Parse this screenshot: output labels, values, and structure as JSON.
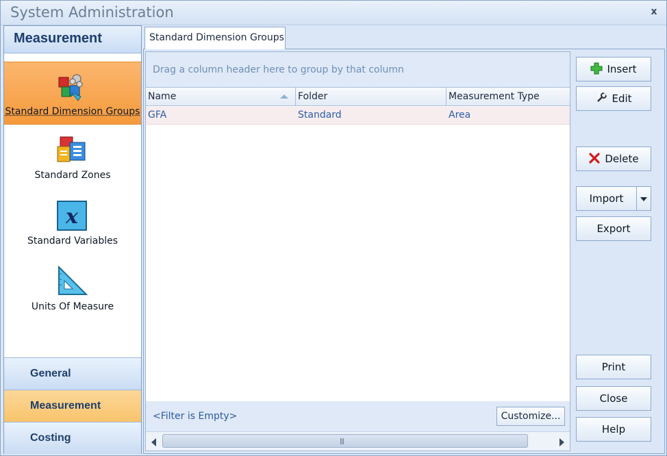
{
  "window": {
    "title": "System Administration",
    "close_glyph": "x"
  },
  "nav": {
    "header": "Measurement",
    "items": [
      {
        "label": "Standard Dimension Groups",
        "icon": "dimension-groups-icon",
        "selected": true
      },
      {
        "label": "Standard Zones",
        "icon": "zones-icon",
        "selected": false
      },
      {
        "label": "Standard Variables",
        "icon": "variables-icon",
        "selected": false
      },
      {
        "label": "Units Of Measure",
        "icon": "units-icon",
        "selected": false
      }
    ],
    "sections": [
      {
        "label": "General",
        "active": false
      },
      {
        "label": "Measurement",
        "active": true
      },
      {
        "label": "Costing",
        "active": false
      }
    ]
  },
  "tabs": [
    {
      "label": "Standard Dimension Groups"
    }
  ],
  "grid": {
    "group_hint": "Drag a column header here to group by that column",
    "columns": [
      "Name",
      "Folder",
      "Measurement Type"
    ],
    "rows": [
      [
        "GFA",
        "Standard",
        "Area"
      ]
    ],
    "filter_text": "<Filter is Empty>",
    "customize_label": "Customize..."
  },
  "buttons": {
    "insert": "Insert",
    "edit": "Edit",
    "delete": "Delete",
    "import": "Import",
    "export": "Export",
    "print": "Print",
    "close": "Close",
    "help": "Help"
  },
  "colors": {
    "accent_orange": "#f59a3c",
    "link_blue": "#2a5ea8",
    "header_blue": "#1d3e6e"
  }
}
